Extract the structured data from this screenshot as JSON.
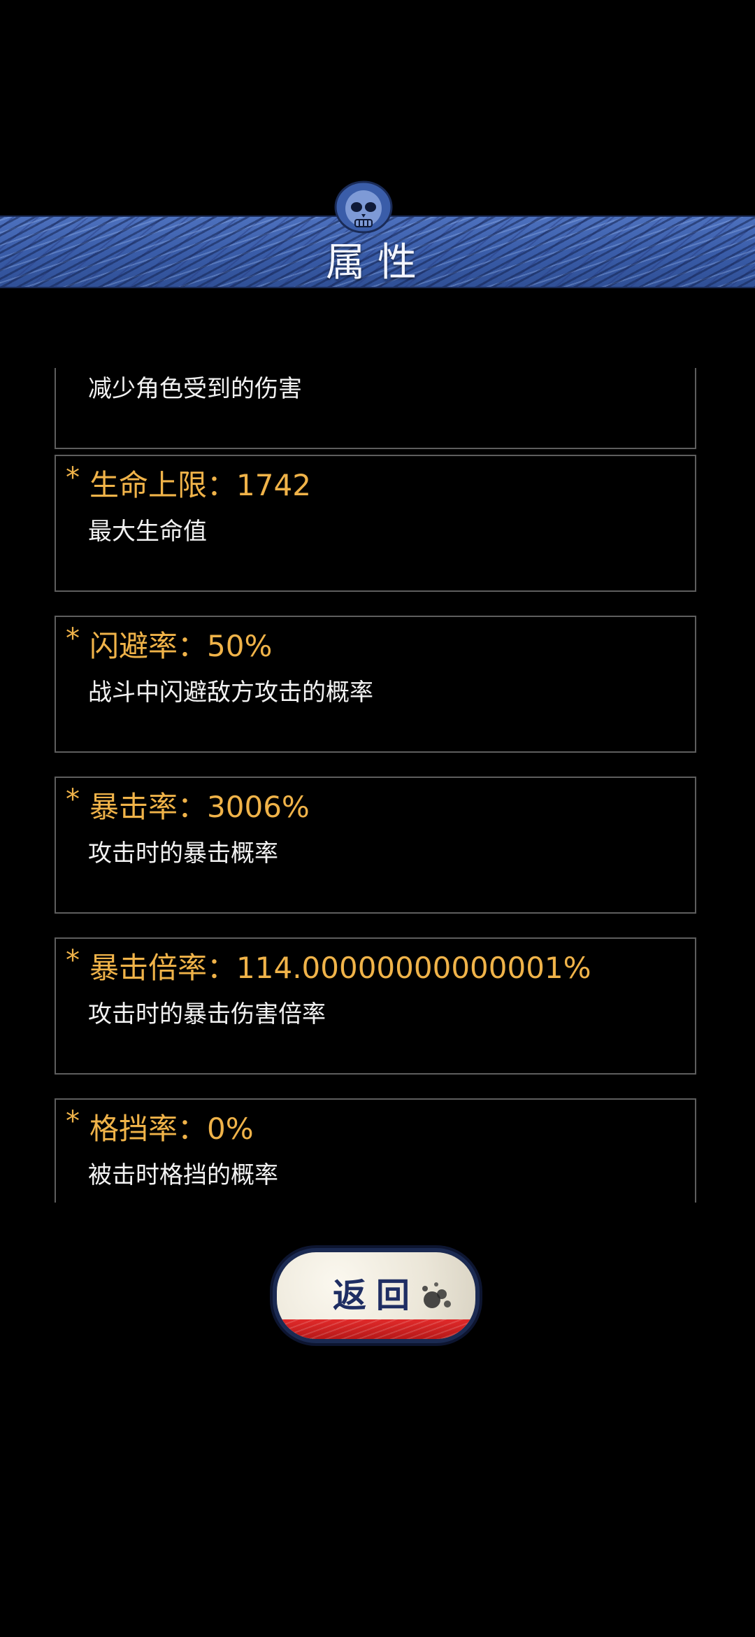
{
  "header": {
    "title": "属性",
    "icon": "skull-icon"
  },
  "attributes": [
    {
      "name": "",
      "value": "",
      "description": "减少角色受到的伤害"
    },
    {
      "name": "生命上限",
      "value": "1742",
      "description": "最大生命值"
    },
    {
      "name": "闪避率",
      "value": "50%",
      "description": "战斗中闪避敌方攻击的概率"
    },
    {
      "name": "暴击率",
      "value": "3006%",
      "description": "攻击时的暴击概率"
    },
    {
      "name": "暴击倍率",
      "value": "114.00000000000001%",
      "description": "攻击时的暴击伤害倍率"
    },
    {
      "name": "格挡率",
      "value": "0%",
      "description": "被击时格挡的概率"
    }
  ],
  "labels": {
    "star": "*",
    "separator": "："
  },
  "footer": {
    "return_label": "返回"
  },
  "colors": {
    "background": "#000000",
    "banner_blue": "#3a5da9",
    "title_gold": "#f0b349",
    "card_border": "#5e5e5e",
    "button_red": "#d42222",
    "button_text": "#1f2e63"
  }
}
